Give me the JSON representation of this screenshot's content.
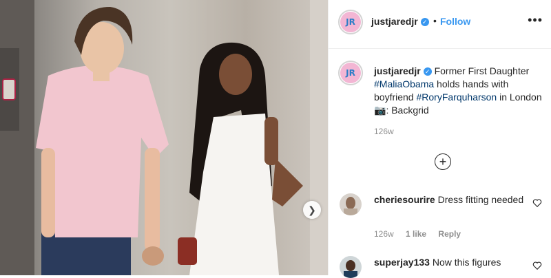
{
  "post": {
    "username": "justjaredjr",
    "follow_label": "Follow",
    "more_icon": "more-dots-icon",
    "avatar_text": "JR",
    "caption": {
      "username": "justjaredjr",
      "text_1": "Former First Daughter",
      "tag_1": "#MaliaObama",
      "text_2": "holds hands with boyfriend",
      "tag_2": "#RoryFarquharson",
      "text_3": "in London",
      "camera_emoji": "📷",
      "text_4": ": Backgrid",
      "time": "126w"
    },
    "comments": [
      {
        "username": "cheriesourire",
        "text": "Dress fitting needed",
        "time": "126w",
        "likes": "1 like",
        "reply": "Reply"
      },
      {
        "username": "superjay133",
        "text": "Now this figures"
      }
    ],
    "accent_color": "#3897f0"
  }
}
